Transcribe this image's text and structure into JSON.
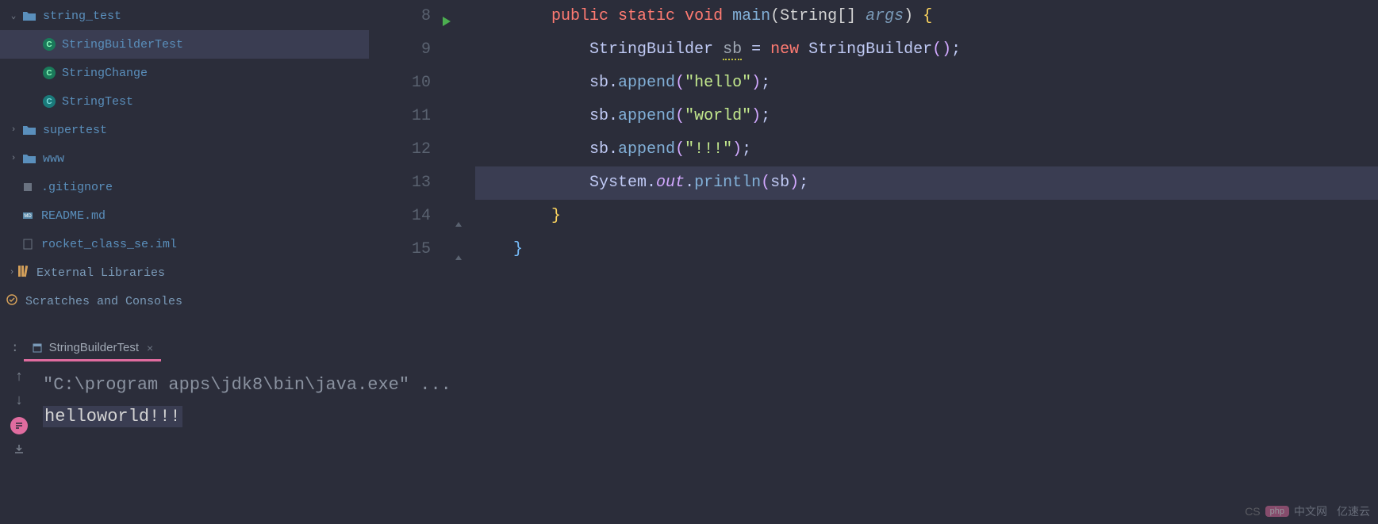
{
  "sidebar": {
    "tree": [
      {
        "type": "folder",
        "label": "string_test",
        "depth": 0,
        "expanded": true
      },
      {
        "type": "class-run",
        "label": "StringBuilderTest",
        "depth": 1,
        "selected": true
      },
      {
        "type": "class-run",
        "label": "StringChange",
        "depth": 1
      },
      {
        "type": "class",
        "label": "StringTest",
        "depth": 1
      },
      {
        "type": "folder",
        "label": "supertest",
        "depth": 0,
        "expanded": false
      },
      {
        "type": "folder",
        "label": "www",
        "depth": 0,
        "expanded": false
      },
      {
        "type": "file",
        "label": ".gitignore",
        "depth": 0,
        "icon": "gitignore"
      },
      {
        "type": "file",
        "label": "README.md",
        "depth": 0,
        "icon": "md"
      },
      {
        "type": "file",
        "label": "rocket_class_se.iml",
        "depth": 0,
        "icon": "iml"
      }
    ],
    "external_libraries": "External Libraries",
    "scratches": "Scratches and Consoles"
  },
  "editor": {
    "lines": [
      {
        "num": 8,
        "run_gutter": true,
        "tokens": [
          {
            "c": "kw",
            "t": "public"
          },
          {
            "c": "default",
            "t": " "
          },
          {
            "c": "kw",
            "t": "static"
          },
          {
            "c": "default",
            "t": " "
          },
          {
            "c": "kw",
            "t": "void"
          },
          {
            "c": "default",
            "t": " "
          },
          {
            "c": "method",
            "t": "main"
          },
          {
            "c": "paren",
            "t": "(String[] "
          },
          {
            "c": "args-it",
            "t": "args"
          },
          {
            "c": "paren",
            "t": ") "
          },
          {
            "c": "brace",
            "t": "{"
          }
        ],
        "indent": 8
      },
      {
        "num": 9,
        "tokens": [
          {
            "c": "default",
            "t": "StringBuilder "
          },
          {
            "c": "warn",
            "t": "sb"
          },
          {
            "c": "default",
            "t": " = "
          },
          {
            "c": "new",
            "t": "new"
          },
          {
            "c": "default",
            "t": " StringBuilder"
          },
          {
            "c": "brace-g",
            "t": "()"
          },
          {
            "c": "semi",
            "t": ";"
          }
        ],
        "indent": 12
      },
      {
        "num": 10,
        "tokens": [
          {
            "c": "default",
            "t": "sb."
          },
          {
            "c": "method",
            "t": "append"
          },
          {
            "c": "brace-g",
            "t": "("
          },
          {
            "c": "string",
            "t": "\"hello\""
          },
          {
            "c": "brace-g",
            "t": ")"
          },
          {
            "c": "semi",
            "t": ";"
          }
        ],
        "indent": 12
      },
      {
        "num": 11,
        "tokens": [
          {
            "c": "default",
            "t": "sb."
          },
          {
            "c": "method",
            "t": "append"
          },
          {
            "c": "brace-g",
            "t": "("
          },
          {
            "c": "string",
            "t": "\"world\""
          },
          {
            "c": "brace-g",
            "t": ")"
          },
          {
            "c": "semi",
            "t": ";"
          }
        ],
        "indent": 12
      },
      {
        "num": 12,
        "tokens": [
          {
            "c": "default",
            "t": "sb."
          },
          {
            "c": "method",
            "t": "append"
          },
          {
            "c": "brace-g",
            "t": "("
          },
          {
            "c": "string",
            "t": "\"!!!\""
          },
          {
            "c": "brace-g",
            "t": ")"
          },
          {
            "c": "semi",
            "t": ";"
          }
        ],
        "indent": 12
      },
      {
        "num": 13,
        "highlight": true,
        "tokens": [
          {
            "c": "default",
            "t": "System."
          },
          {
            "c": "static-field",
            "t": "out"
          },
          {
            "c": "default",
            "t": "."
          },
          {
            "c": "method",
            "t": "println"
          },
          {
            "c": "brace-g",
            "t": "("
          },
          {
            "c": "default",
            "t": "sb"
          },
          {
            "c": "brace-g",
            "t": ")"
          },
          {
            "c": "semi",
            "t": ";"
          }
        ],
        "indent": 12
      },
      {
        "num": 14,
        "fold_close": true,
        "tokens": [
          {
            "c": "brace",
            "t": "}"
          }
        ],
        "indent": 8
      },
      {
        "num": 15,
        "fold_close": true,
        "tokens": [
          {
            "c": "brace-b",
            "t": "}"
          }
        ],
        "indent": 4
      }
    ]
  },
  "run_panel": {
    "tab_label": "StringBuilderTest",
    "cmd_line": "\"C:\\program apps\\jdk8\\bin\\java.exe\" ...",
    "output": "helloworld!!!"
  },
  "watermark": {
    "badge": "php",
    "text1": "中文网",
    "text2": "亿速云",
    "cs": "CS"
  }
}
